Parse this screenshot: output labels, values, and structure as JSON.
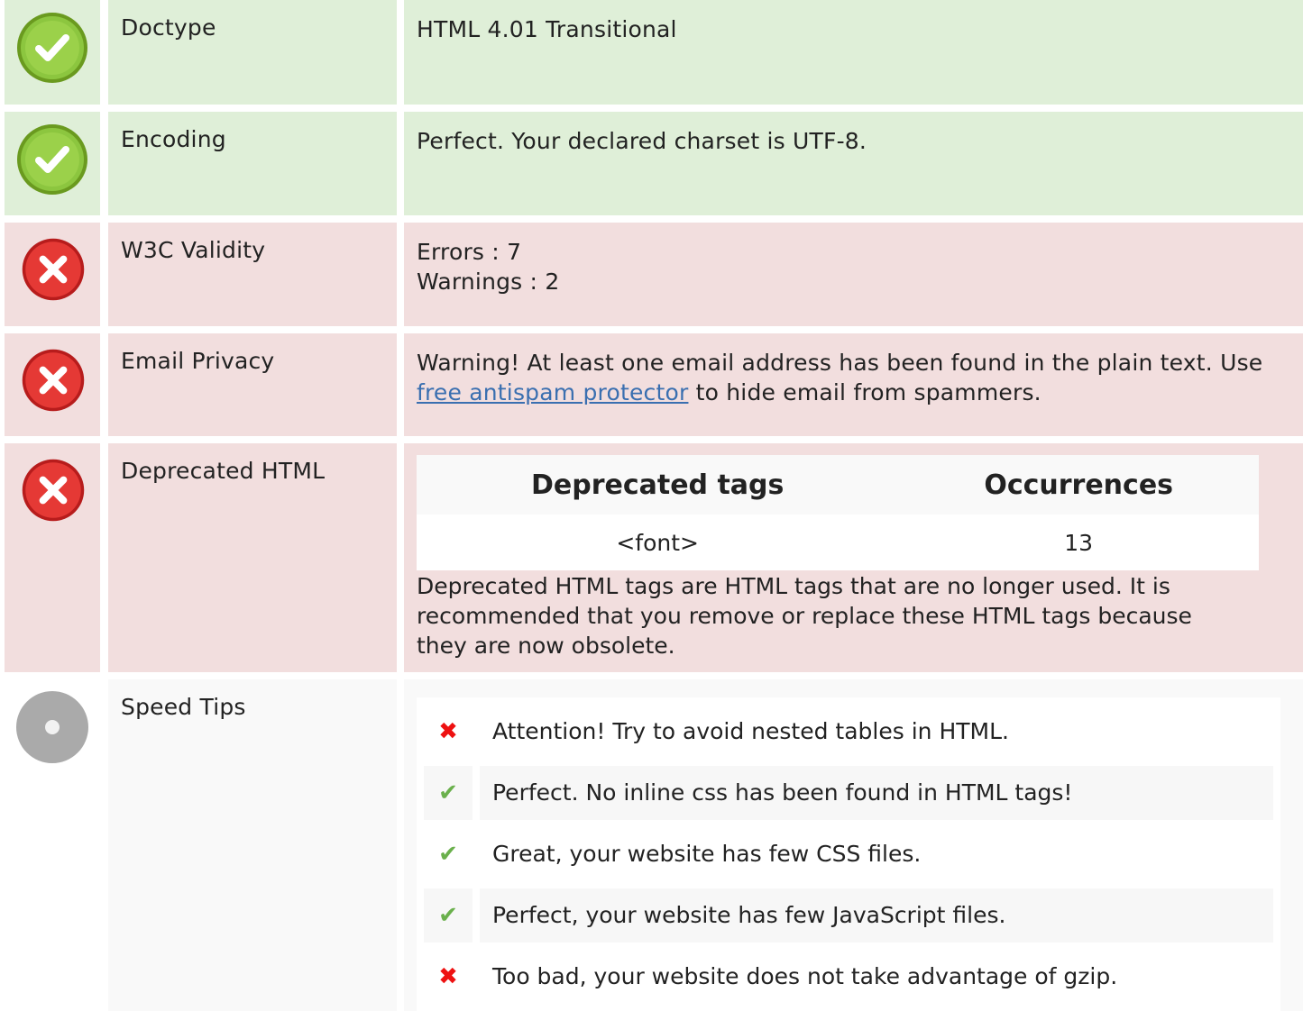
{
  "rows": {
    "doctype": {
      "label": "Doctype",
      "value": "HTML 4.01 Transitional",
      "status": "ok"
    },
    "encoding": {
      "label": "Encoding",
      "value": "Perfect. Your declared charset is UTF-8.",
      "status": "ok"
    },
    "w3c": {
      "label": "W3C Validity",
      "errors": "Errors : 7",
      "warnings": "Warnings : 2",
      "status": "error"
    },
    "email": {
      "label": "Email Privacy",
      "text_before": "Warning! At least one email address has been found in the plain text. Use ",
      "link_text": "free antispam protector",
      "text_after": " to hide email from spammers.",
      "status": "error"
    },
    "deprecated": {
      "label": "Deprecated HTML",
      "col_tags": "Deprecated tags",
      "col_occurrences": "Occurrences",
      "tag": "<font>",
      "count": "13",
      "note": "Deprecated HTML tags are HTML tags that are no longer used. It is recommended that you remove or replace these HTML tags because they are now obsolete.",
      "status": "error"
    },
    "speed": {
      "label": "Speed Tips",
      "status": "neutral",
      "tips": [
        {
          "mark": "✖",
          "result": "fail",
          "text": "Attention! Try to avoid nested tables in HTML."
        },
        {
          "mark": "✔",
          "result": "pass",
          "text": "Perfect. No inline css has been found in HTML tags!"
        },
        {
          "mark": "✔",
          "result": "pass",
          "text": "Great, your website has few CSS files."
        },
        {
          "mark": "✔",
          "result": "pass",
          "text": "Perfect, your website has few JavaScript files."
        },
        {
          "mark": "✖",
          "result": "fail",
          "text": "Too bad, your website does not take advantage of gzip."
        }
      ]
    }
  },
  "colors": {
    "ok_bg": "#dfefd8",
    "error_bg": "#f2dede",
    "neutral_bg": "#f5f5f5",
    "ok_icon": "#8cc63f",
    "error_icon": "#e53935",
    "neutral_icon": "#aaaaaa",
    "link": "#3a6fb0"
  },
  "icons": {
    "ok": "check-circle-icon",
    "error": "x-circle-icon",
    "neutral": "grey-dot-icon"
  }
}
